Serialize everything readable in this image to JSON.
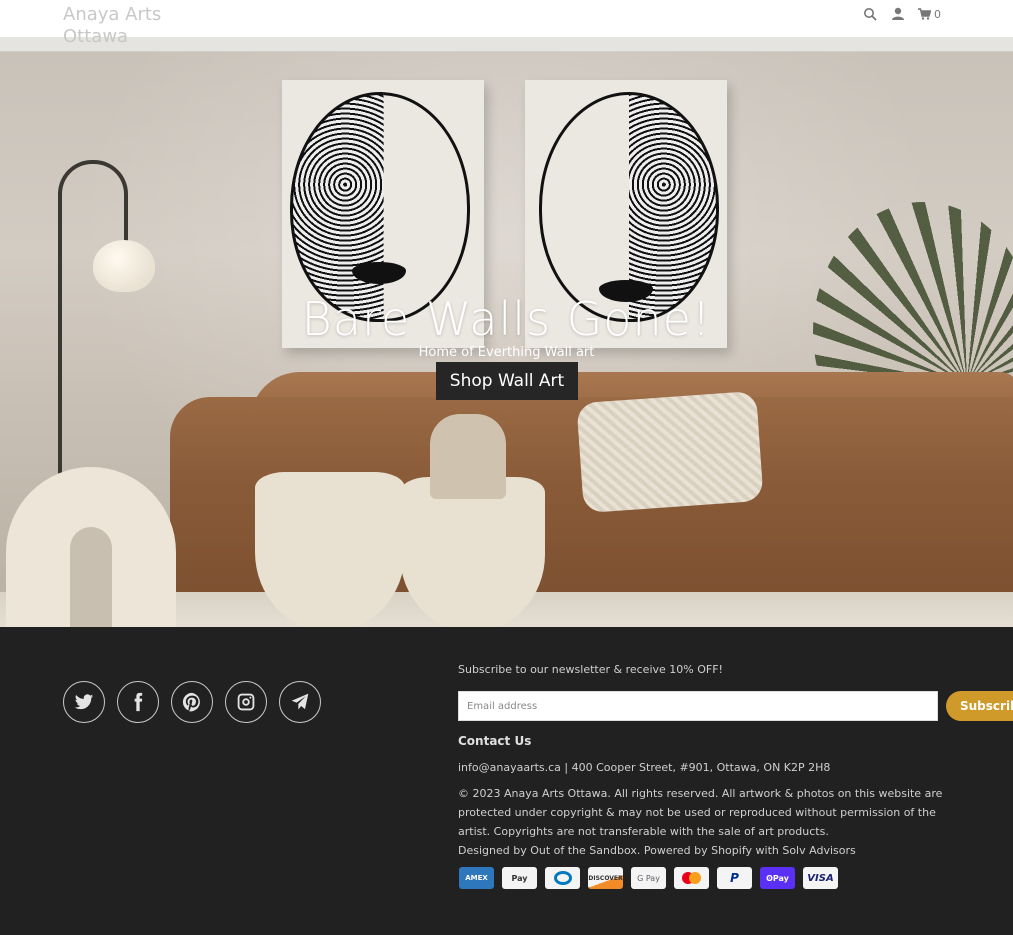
{
  "header": {
    "logo_line1": "Anaya Arts",
    "logo_line2": "Ottawa",
    "icons": [
      "search-icon",
      "account-icon",
      "cart-icon"
    ],
    "cart_count": "0"
  },
  "hero": {
    "title": "Bare Walls Gone!",
    "subtitle": "Home of Everthing Wall art",
    "button_label": "Shop Wall Art"
  },
  "footer": {
    "social": [
      "twitter",
      "facebook",
      "pinterest",
      "instagram",
      "email"
    ],
    "newsletter_text": "Subscribe to our newsletter & receive 10% OFF!",
    "email_placeholder": "Email address",
    "subscribe_label": "Subscribe",
    "contact_title": "Contact Us",
    "contact_line": "info@anayaarts.ca | 400 Cooper Street, #901, Ottawa, ON K2P 2H8",
    "copyright_1": "© 2023 Anaya Arts Ottawa. All rights reserved. All artwork & photos on this website are protected under copyright & may not be used or reproduced without permission of the artist. Copyrights are not transferable with the sale of art products.",
    "credits": "Designed by Out of the Sandbox. Powered by Shopify with Solv Advisors",
    "payments": {
      "amex": "AMEX",
      "apple_pay": " Pay",
      "discover": "DISCOVER",
      "google_pay": "G Pay",
      "paypal": "P",
      "shop_pay": "ʘPay",
      "visa": "VISA"
    },
    "accent_color": "#d09a2a"
  }
}
